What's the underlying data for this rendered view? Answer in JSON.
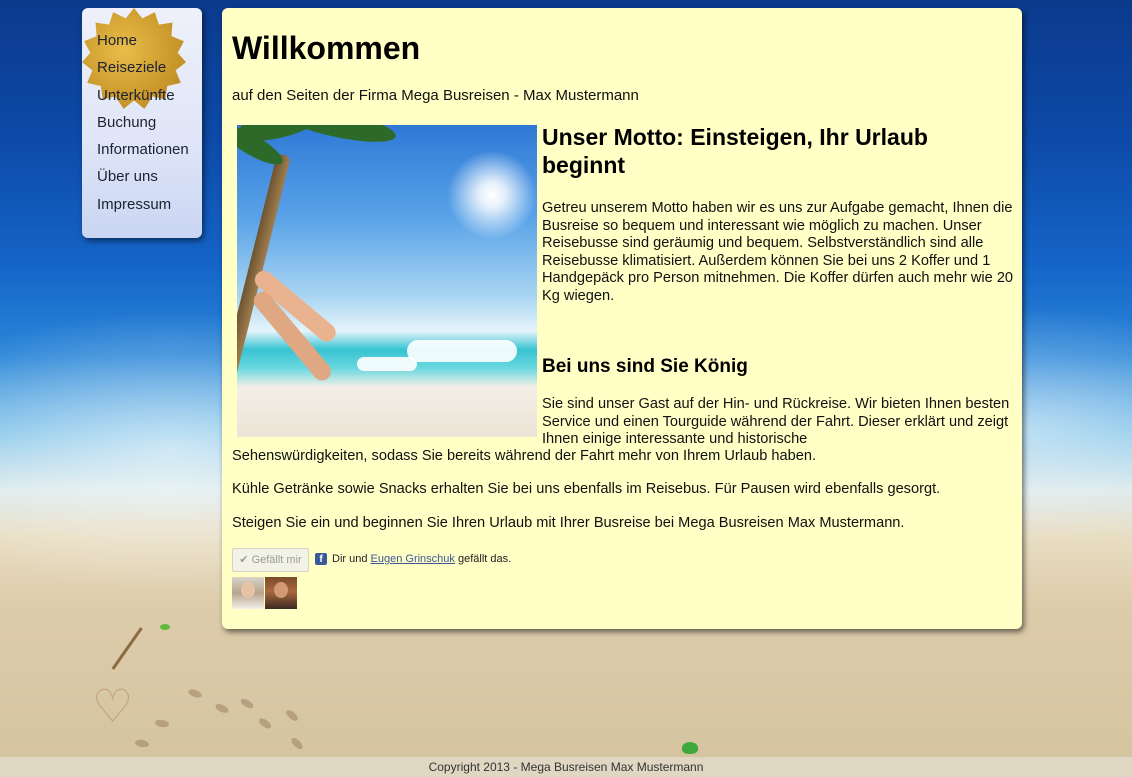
{
  "nav": {
    "items": [
      {
        "label": "Home"
      },
      {
        "label": "Reiseziele"
      },
      {
        "label": "Unterkünfte"
      },
      {
        "label": "Buchung"
      },
      {
        "label": "Informationen"
      },
      {
        "label": "Über uns"
      },
      {
        "label": "Impressum"
      }
    ]
  },
  "main": {
    "title": "Willkommen",
    "intro": "auf den Seiten der Firma Mega Busreisen - Max Mustermann",
    "motto_heading": "Unser Motto: Einsteigen, Ihr Urlaub beginnt",
    "motto_text": "Getreu unserem Motto haben wir es uns zur Aufgabe gemacht, Ihnen die Busreise so bequem und interessant wie möglich zu machen. Unser Reisebusse sind geräumig und bequem. Selbstverständlich sind alle Reisebusse klimatisiert. Außerdem können Sie bei uns 2 Koffer und 1 Handgepäck pro Person mitnehmen. Die Koffer dürfen auch mehr wie 20 Kg wiegen.",
    "koenig_heading": "Bei uns sind Sie König",
    "koenig_text_a": "Sie sind unser Gast auf der Hin- und Rückreise. Wir bieten Ihnen besten Service und einen Tourguide während der Fahrt. Dieser erklärt und zeigt Ihnen einige interessante und historische",
    "koenig_text_b": "Sehenswürdigkeiten, sodass Sie bereits während der Fahrt mehr von Ihrem Urlaub haben.",
    "drinks_text": "Kühle Getränke sowie Snacks erhalten Sie bei uns ebenfalls im Reisebus. Für Pausen wird ebenfalls gesorgt.",
    "closing_text": "Steigen Sie ein und beginnen Sie Ihren Urlaub mit Ihrer Busreise bei Mega Busreisen Max Mustermann."
  },
  "facebook": {
    "like_button": "✔ Gefällt mir",
    "icon_letter": "f",
    "text_prefix": "Dir und",
    "friend_name": "Eugen Grinschuk",
    "text_suffix": "gefällt das."
  },
  "footer": {
    "copyright": "Copyright 2013 - Mega Busreisen Max Mustermann"
  }
}
